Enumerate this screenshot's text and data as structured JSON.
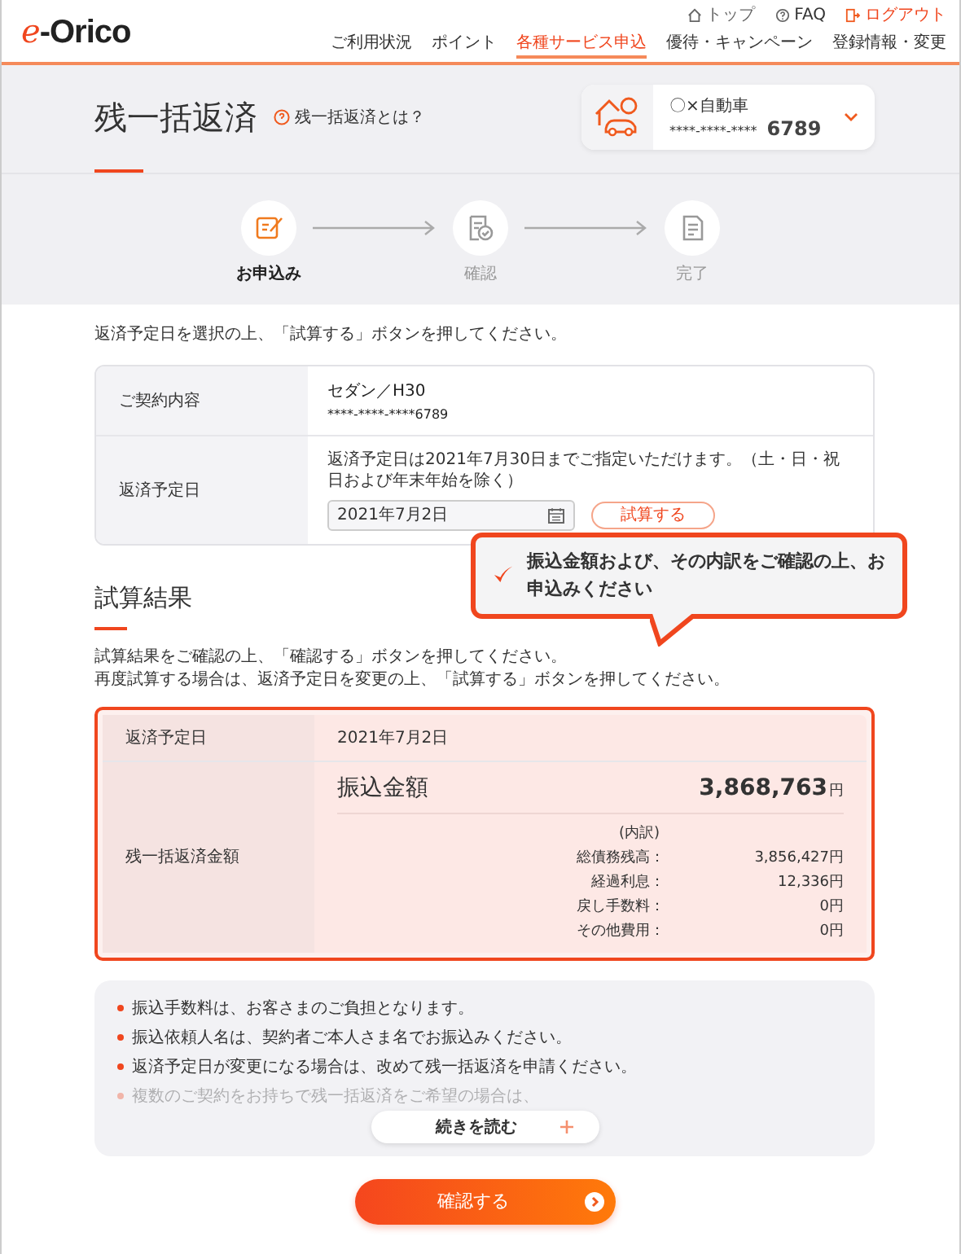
{
  "header": {
    "logo_prefix": "e",
    "logo_rest": "-Orico",
    "utility_links": [
      {
        "label": "トップ",
        "kind": "home"
      },
      {
        "label": "FAQ",
        "kind": "help"
      },
      {
        "label": "ログアウト",
        "kind": "logout"
      }
    ],
    "nav": [
      {
        "label": "ご利用状況",
        "selected": false
      },
      {
        "label": "ポイント",
        "selected": false
      },
      {
        "label": "各種サービス申込",
        "selected": true
      },
      {
        "label": "優待・キャンペーン",
        "selected": false
      },
      {
        "label": "登録情報・変更",
        "selected": false
      }
    ]
  },
  "page_title": "残一括返済",
  "help_link": "残一括返済とは？",
  "account": {
    "name": "〇×自動車",
    "number_mask": "****-****-****",
    "number_tail": "6789"
  },
  "steps": [
    {
      "label": "お申込み",
      "kind": "edit",
      "selected": true
    },
    {
      "label": "確認",
      "kind": "check",
      "selected": false
    },
    {
      "label": "完了",
      "kind": "doc",
      "selected": false
    }
  ],
  "instruction": "返済予定日を選択の上、「試算する」ボタンを押してください。",
  "form": {
    "contract_label": "ご契約内容",
    "contract_lines": [
      "セダン／H30",
      "****-****-****6789"
    ],
    "date_label": "返済予定日",
    "date_note": "返済予定日は2021年7月30日までご指定いただけます。（土・日・祝日および年末年始を除く）",
    "date_value": "2021年7月2日",
    "calc_button": "試算する"
  },
  "result": {
    "title": "試算結果",
    "callout": "振込金額および、その内訳をご確認の上、お申込みください",
    "description": [
      "試算結果をご確認の上、「確認する」ボタンを押してください。",
      "再度試算する場合は、返済予定日を変更の上、「試算する」ボタンを押してください。"
    ],
    "date_label": "返済予定日",
    "date_value": "2021年7月2日",
    "amount_label": "残一括返済金額",
    "transfer_label": "振込金額",
    "transfer_amount": "3,868,763",
    "transfer_unit": "円",
    "breakdown_title": "(内訳)",
    "breakdown": [
      {
        "label": "総債務残高：",
        "value": "3,856,427円"
      },
      {
        "label": "経過利息：",
        "value": "12,336円"
      },
      {
        "label": "戻し手数料：",
        "value": "0円"
      },
      {
        "label": "その他費用：",
        "value": "0円"
      }
    ]
  },
  "notes": [
    {
      "text": "振込手数料は、お客さまのご負担となります。",
      "faded": false
    },
    {
      "text": "振込依頼人名は、契約者ご本人さま名でお振込みください。",
      "faded": false
    },
    {
      "text": "返済予定日が変更になる場合は、改めて残一括返済を申請ください。",
      "faded": false
    },
    {
      "text": "複数のご契約をお持ちで残一括返済をご希望の場合は、",
      "faded": true
    }
  ],
  "read_more": "続きを読む",
  "confirm": "確認する"
}
